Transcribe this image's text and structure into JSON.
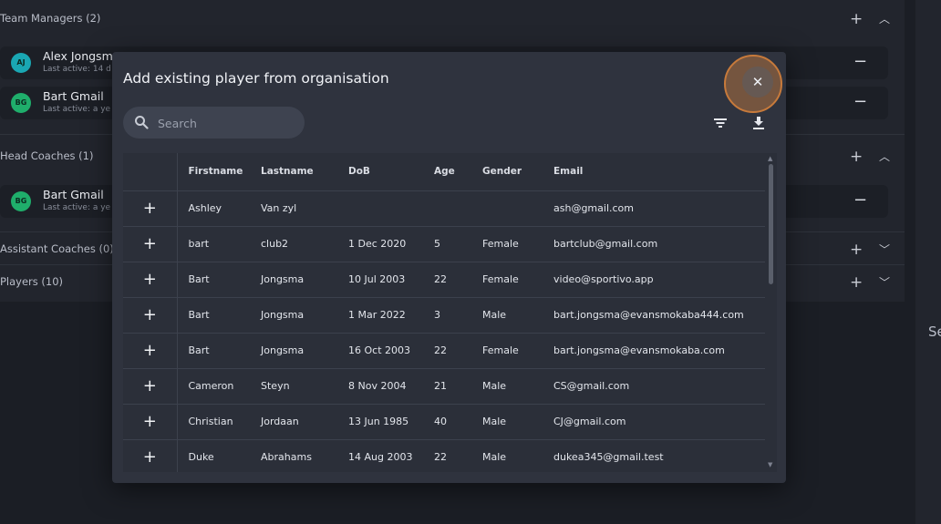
{
  "background": {
    "right_text": "Se",
    "sections": [
      {
        "title": "Team Managers (2)",
        "expanded": true
      },
      {
        "title": "Head Coaches (1)",
        "expanded": true
      },
      {
        "title": "Assistant Coaches (0)",
        "expanded": false
      },
      {
        "title": "Players (10)",
        "expanded": false
      }
    ],
    "team_managers": [
      {
        "initials": "AJ",
        "name": "Alex Jongsm",
        "sub": "Last active: 14 d",
        "color": "#1aa7b3"
      },
      {
        "initials": "BG",
        "name": "Bart Gmail",
        "sub": "Last active: a ye",
        "color": "#1fae6b"
      }
    ],
    "head_coaches": [
      {
        "initials": "BG",
        "name": "Bart Gmail",
        "sub": "Last active: a ye",
        "color": "#1fae6b"
      }
    ]
  },
  "modal": {
    "title": "Add existing player from organisation",
    "close_icon": "close-icon",
    "search": {
      "placeholder": "Search",
      "value": ""
    },
    "toolbar": {
      "filter_icon": "filter-icon",
      "download_icon": "download-icon"
    },
    "columns": [
      "Firstname",
      "Lastname",
      "DoB",
      "Age",
      "Gender",
      "Email"
    ],
    "rows": [
      {
        "first": "Ashley",
        "last": "Van zyl",
        "dob": "",
        "age": "",
        "gender": "",
        "email": "ash@gmail.com"
      },
      {
        "first": "bart",
        "last": "club2",
        "dob": "1 Dec 2020",
        "age": "5",
        "gender": "Female",
        "email": "bartclub@gmail.com"
      },
      {
        "first": "Bart",
        "last": "Jongsma",
        "dob": "10 Jul 2003",
        "age": "22",
        "gender": "Female",
        "email": "video@sportivo.app"
      },
      {
        "first": "Bart",
        "last": "Jongsma",
        "dob": "1 Mar 2022",
        "age": "3",
        "gender": "Male",
        "email": "bart.jongsma@evansmokaba444.com"
      },
      {
        "first": "Bart",
        "last": "Jongsma",
        "dob": "16 Oct 2003",
        "age": "22",
        "gender": "Female",
        "email": "bart.jongsma@evansmokaba.com"
      },
      {
        "first": "Cameron",
        "last": "Steyn",
        "dob": "8 Nov 2004",
        "age": "21",
        "gender": "Male",
        "email": "CS@gmail.com"
      },
      {
        "first": "Christian",
        "last": "Jordaan",
        "dob": "13 Jun 1985",
        "age": "40",
        "gender": "Male",
        "email": "CJ@gmail.com"
      },
      {
        "first": "Duke",
        "last": "Abrahams",
        "dob": "14 Aug 2003",
        "age": "22",
        "gender": "Male",
        "email": "dukea345@gmail.test"
      }
    ]
  }
}
